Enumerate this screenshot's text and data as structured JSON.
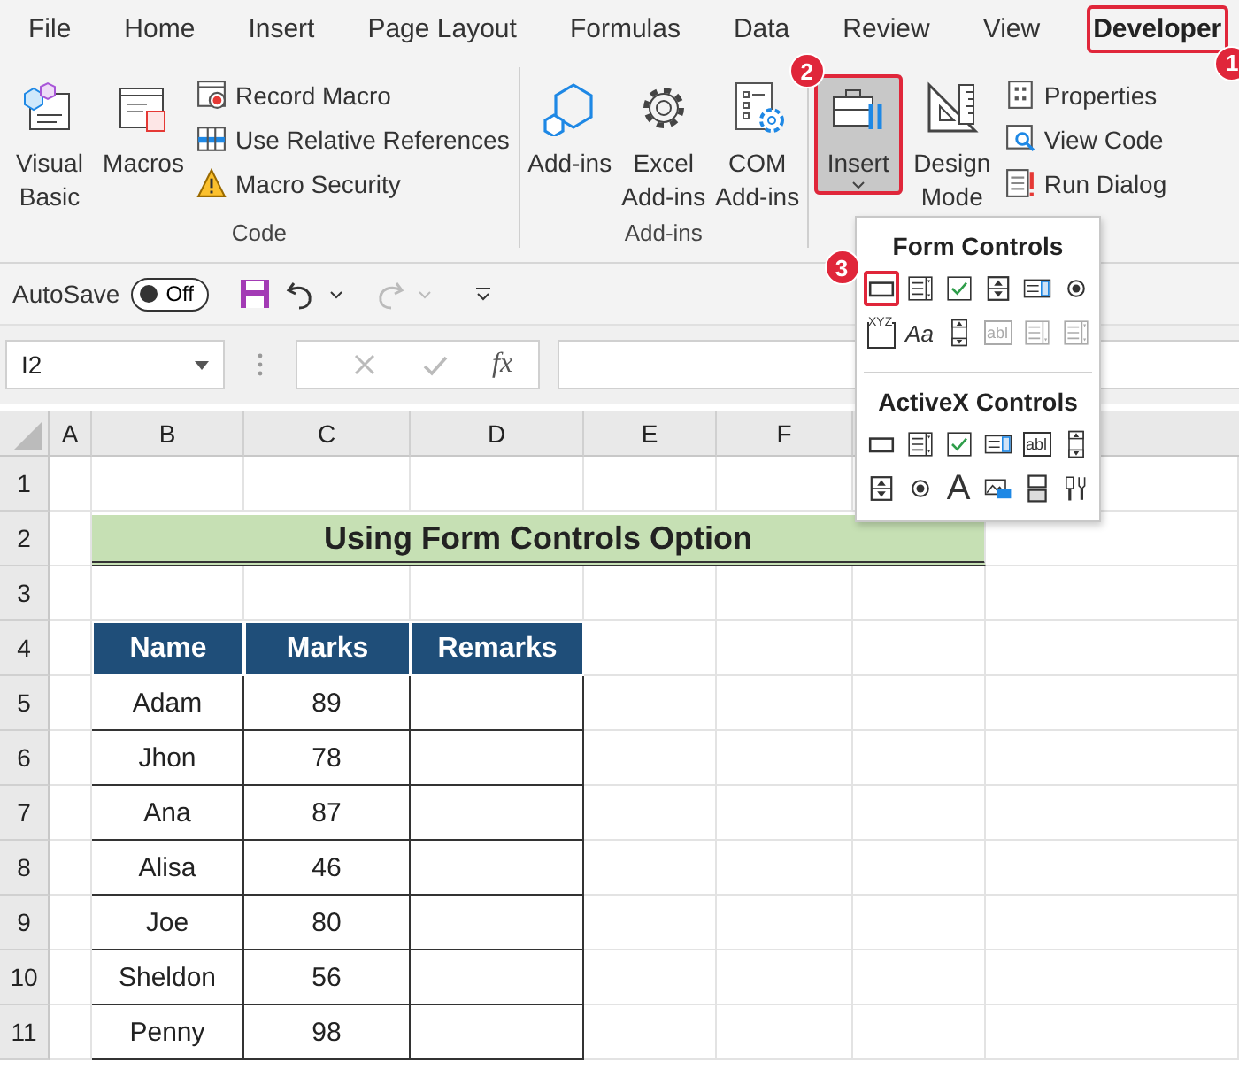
{
  "menu_tabs": [
    {
      "label": "File",
      "selected": false
    },
    {
      "label": "Home",
      "selected": false
    },
    {
      "label": "Insert",
      "selected": false
    },
    {
      "label": "Page Layout",
      "selected": false
    },
    {
      "label": "Formulas",
      "selected": false
    },
    {
      "label": "Data",
      "selected": false
    },
    {
      "label": "Review",
      "selected": false
    },
    {
      "label": "View",
      "selected": false
    },
    {
      "label": "Developer",
      "selected": true,
      "callout": "1"
    }
  ],
  "ribbon_groups": [
    {
      "label": "Code",
      "large_buttons": [
        {
          "kind": "vba",
          "label": "Visual Basic"
        },
        {
          "kind": "macros",
          "label": "Macros"
        }
      ],
      "small_buttons": [
        {
          "kind": "record",
          "label": "Record Macro"
        },
        {
          "kind": "relative",
          "label": "Use Relative References"
        },
        {
          "kind": "security",
          "label": "Macro Security"
        }
      ]
    },
    {
      "label": "Add-ins",
      "large_buttons": [
        {
          "kind": "addins",
          "label": "Add-ins"
        },
        {
          "kind": "excel_addins",
          "label": "Excel Add-ins"
        },
        {
          "kind": "com_addins",
          "label": "COM Add-ins"
        }
      ]
    },
    {
      "large_buttons": [
        {
          "kind": "insert",
          "label": "Insert",
          "selected": true,
          "callout": "2"
        },
        {
          "kind": "design",
          "label": "Design Mode",
          "selected": false
        }
      ],
      "small_buttons": [
        {
          "kind": "properties",
          "label": "Properties"
        },
        {
          "kind": "viewcode",
          "label": "View Code"
        },
        {
          "kind": "rundialog",
          "label": "Run Dialog"
        }
      ]
    }
  ],
  "quick_access": {
    "autosave_label": "AutoSave",
    "autosave": {
      "on": false,
      "label": "Off"
    },
    "redo_disabled": true
  },
  "formula_bar": {
    "name_box": "I2",
    "function_label": "fx"
  },
  "column_headers": [
    "A",
    "B",
    "C",
    "D",
    "E",
    "F"
  ],
  "row_headers": [
    "1",
    "2",
    "3",
    "4",
    "5",
    "6",
    "7",
    "8",
    "9",
    "10",
    "11"
  ],
  "sheet": {
    "title": "Using Form Controls Option",
    "columns": [
      "Name",
      "Marks",
      "Remarks"
    ],
    "rows": [
      {
        "name": "Adam",
        "marks": "89"
      },
      {
        "name": "Jhon",
        "marks": "78"
      },
      {
        "name": "Ana",
        "marks": "87"
      },
      {
        "name": "Alisa",
        "marks": "46"
      },
      {
        "name": "Joe",
        "marks": "80"
      },
      {
        "name": "Sheldon",
        "marks": "56"
      },
      {
        "name": "Penny",
        "marks": "98"
      }
    ]
  },
  "insert_menu": {
    "sections": [
      {
        "title": "Form Controls",
        "controls": [
          {
            "kind": "button",
            "disabled": false,
            "callout": "3"
          },
          {
            "kind": "combo",
            "disabled": false
          },
          {
            "kind": "checkbox",
            "disabled": false
          },
          {
            "kind": "spin",
            "disabled": false
          },
          {
            "kind": "listbox",
            "disabled": false
          },
          {
            "kind": "option",
            "disabled": false
          },
          {
            "kind": "groupbox",
            "glyph": "XYZ",
            "disabled": false
          },
          {
            "kind": "label",
            "glyph": "Aa",
            "disabled": false
          },
          {
            "kind": "scrollbar",
            "disabled": false
          },
          {
            "kind": "textfield",
            "glyph": "abl",
            "disabled": true
          },
          {
            "kind": "combolist",
            "disabled": true
          },
          {
            "kind": "combo",
            "disabled": true
          }
        ]
      },
      {
        "title": "ActiveX Controls",
        "controls": [
          {
            "kind": "button",
            "disabled": false
          },
          {
            "kind": "combo",
            "disabled": false
          },
          {
            "kind": "checkbox",
            "disabled": false
          },
          {
            "kind": "listbox",
            "disabled": false
          },
          {
            "kind": "textfield",
            "glyph": "abl",
            "disabled": false
          },
          {
            "kind": "scrollbar",
            "disabled": false
          },
          {
            "kind": "spin",
            "disabled": false
          },
          {
            "kind": "option",
            "disabled": false
          },
          {
            "kind": "label",
            "glyph": "A",
            "disabled": false
          },
          {
            "kind": "image",
            "disabled": false
          },
          {
            "kind": "toggle",
            "disabled": false
          },
          {
            "kind": "more",
            "disabled": false
          }
        ]
      }
    ]
  }
}
